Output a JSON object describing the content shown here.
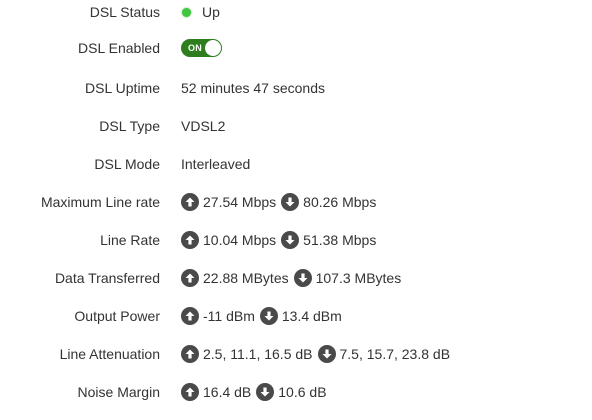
{
  "rows": [
    {
      "label": "DSL Status",
      "value": "Up",
      "status_color": "#3fc53f"
    },
    {
      "label": "DSL Enabled",
      "toggle_label": "ON",
      "toggle_color": "#2e7d1e"
    },
    {
      "label": "DSL Uptime",
      "value": "52 minutes 47 seconds"
    },
    {
      "label": "DSL Type",
      "value": "VDSL2"
    },
    {
      "label": "DSL Mode",
      "value": "Interleaved"
    },
    {
      "label": "Maximum Line rate",
      "up": "27.54 Mbps",
      "down": "80.26 Mbps"
    },
    {
      "label": "Line Rate",
      "up": "10.04 Mbps",
      "down": "51.38 Mbps"
    },
    {
      "label": "Data Transferred",
      "up": "22.88 MBytes",
      "down": "107.3 MBytes"
    },
    {
      "label": "Output Power",
      "up": "-11 dBm",
      "down": "13.4 dBm"
    },
    {
      "label": "Line Attenuation",
      "up": "2.5, 11.1, 16.5 dB",
      "down": "7.5, 15.7, 23.8 dB"
    },
    {
      "label": "Noise Margin",
      "up": "16.4 dB",
      "down": "10.6 dB"
    }
  ],
  "icons": {
    "up": "arrow-up-icon",
    "down": "arrow-down-icon",
    "status": "status-dot-icon"
  }
}
